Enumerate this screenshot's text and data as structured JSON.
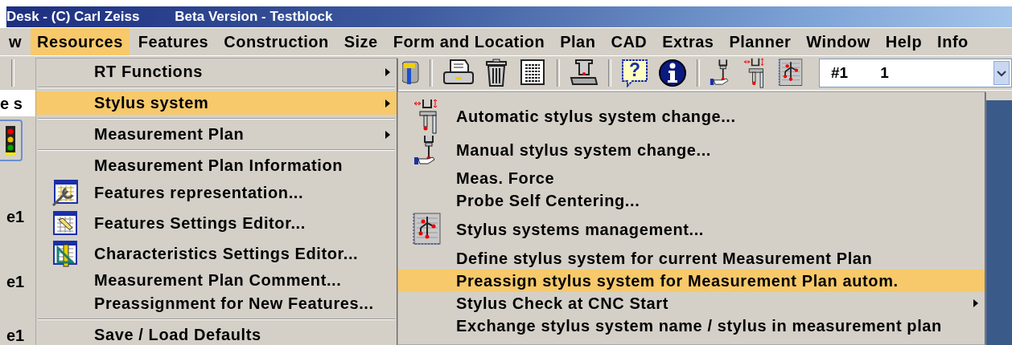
{
  "window": {
    "title": "Desk - (C) Carl Zeiss",
    "subtitle": "Beta Version - Testblock"
  },
  "menu_bar": [
    {
      "label": "w",
      "selected": false
    },
    {
      "label": "Resources",
      "selected": true
    },
    {
      "label": "Features",
      "selected": false
    },
    {
      "label": "Construction",
      "selected": false
    },
    {
      "label": "Size",
      "selected": false
    },
    {
      "label": "Form and Location",
      "selected": false
    },
    {
      "label": "Plan",
      "selected": false
    },
    {
      "label": "CAD",
      "selected": false
    },
    {
      "label": "Extras",
      "selected": false
    },
    {
      "label": "Planner",
      "selected": false
    },
    {
      "label": "Window",
      "selected": false
    },
    {
      "label": "Help",
      "selected": false
    },
    {
      "label": "Info",
      "selected": false
    }
  ],
  "toolbar": {
    "help_glyph": "?",
    "selector": {
      "number": "#1",
      "value": "1"
    }
  },
  "work_area": {
    "field_text": "e s",
    "labels": [
      "e1",
      "e1",
      "e1"
    ]
  },
  "resources_menu": [
    {
      "kind": "item",
      "label": "RT Functions",
      "has_submenu": true,
      "selected": false
    },
    {
      "kind": "separator"
    },
    {
      "kind": "item",
      "label": "Stylus system",
      "has_submenu": true,
      "selected": true
    },
    {
      "kind": "separator"
    },
    {
      "kind": "item",
      "label": "Measurement Plan",
      "has_submenu": true,
      "selected": false
    },
    {
      "kind": "separator"
    },
    {
      "kind": "item",
      "label": "Measurement Plan Information",
      "has_submenu": false,
      "selected": false
    },
    {
      "kind": "item",
      "label": "Features representation...",
      "has_submenu": false,
      "selected": false
    },
    {
      "kind": "item",
      "label": "Features Settings Editor...",
      "has_submenu": false,
      "selected": false
    },
    {
      "kind": "item",
      "label": "Characteristics Settings Editor...",
      "has_submenu": false,
      "selected": false
    },
    {
      "kind": "item",
      "label": "Measurement Plan Comment...",
      "has_submenu": false,
      "selected": false
    },
    {
      "kind": "item",
      "label": "Preassignment for New Features...",
      "has_submenu": false,
      "selected": false
    },
    {
      "kind": "separator"
    },
    {
      "kind": "item",
      "label": "Save / Load Defaults",
      "has_submenu": false,
      "selected": false
    }
  ],
  "stylus_submenu": [
    {
      "kind": "item",
      "label": "Automatic stylus system change...",
      "has_submenu": false,
      "selected": false
    },
    {
      "kind": "item",
      "label": "Manual stylus system change...",
      "has_submenu": false,
      "selected": false
    },
    {
      "kind": "item",
      "label": "Meas. Force",
      "has_submenu": false,
      "selected": false
    },
    {
      "kind": "item",
      "label": "Probe Self Centering...",
      "has_submenu": false,
      "selected": false
    },
    {
      "kind": "item",
      "label": "Stylus systems management...",
      "has_submenu": false,
      "selected": false
    },
    {
      "kind": "item",
      "label": "Define stylus system for current Measurement Plan",
      "has_submenu": false,
      "selected": false
    },
    {
      "kind": "item",
      "label": "Preassign stylus system for Measurement Plan autom.",
      "has_submenu": false,
      "selected": true
    },
    {
      "kind": "item",
      "label": "Stylus Check at CNC Start",
      "has_submenu": true,
      "selected": false
    },
    {
      "kind": "item",
      "label": "Exchange stylus system name / stylus in measurement plan",
      "has_submenu": false,
      "selected": false
    }
  ]
}
